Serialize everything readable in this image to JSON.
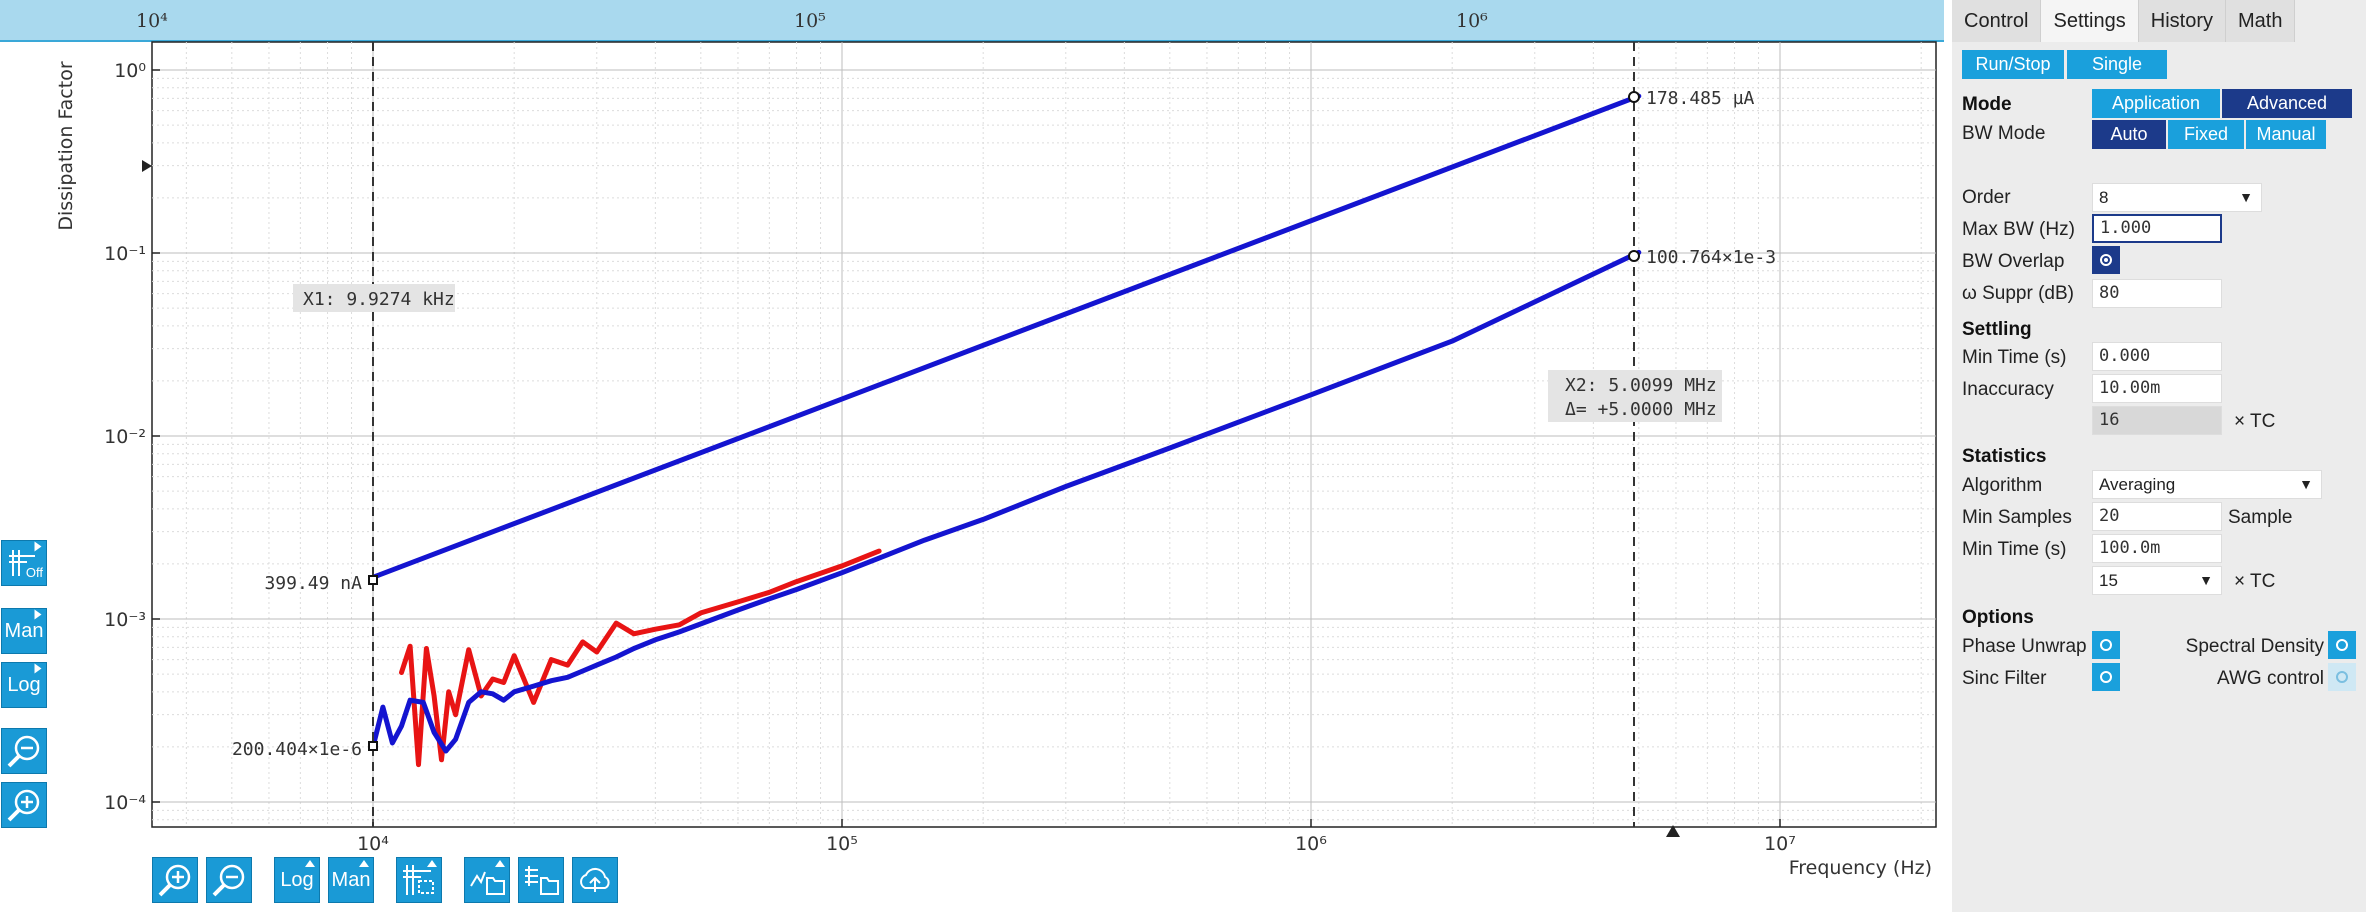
{
  "top_axis": {
    "ticks": [
      "10⁴",
      "10⁵",
      "10⁶"
    ]
  },
  "plot": {
    "y_axis_label": "Dissipation Factor",
    "x_axis_label": "Frequency (Hz)",
    "y_tick_labels": [
      "10⁰",
      "10⁻¹",
      "10⁻²",
      "10⁻³",
      "10⁻⁴"
    ],
    "x_tick_labels": [
      "10⁴",
      "10⁵",
      "10⁶",
      "10⁷"
    ],
    "cursor_x1_label": "X1: 9.9274 kHz",
    "cursor_x2_label": "X2: 5.0099 MHz",
    "cursor_delta_label": "Δ= +5.0000 MHz",
    "marker_upper_left": "399.49 nA",
    "marker_lower_left": "200.404×1e-6",
    "marker_upper_right": "178.485 µA",
    "marker_lower_right": "100.764×1e-3"
  },
  "chart_data": {
    "type": "line",
    "xlabel": "Frequency (Hz)",
    "ylabel": "Dissipation Factor",
    "x_scale": "log",
    "y_scale": "log",
    "xlim": [
      3500,
      25000000
    ],
    "ylim": [
      6e-05,
      1.5
    ],
    "grid": true,
    "series": [
      {
        "color": "#1414d0",
        "x": [
          10000,
          5000000
        ],
        "y": [
          0.00169,
          0.72
        ]
      },
      {
        "color": "#1414d0",
        "x": [
          10000,
          10500,
          11000,
          11500,
          12000,
          12800,
          13500,
          14300,
          15000,
          16000,
          17000,
          18000,
          19000,
          20000,
          22000,
          24000,
          26000,
          28000,
          30000,
          33000,
          36000,
          40000,
          45000,
          50000,
          60000,
          70000,
          80000,
          100000,
          150000,
          200000,
          300000,
          500000,
          1000000,
          2000000,
          5000000
        ],
        "y": [
          0.0002,
          0.00033,
          0.00021,
          0.00026,
          0.00036,
          0.00035,
          0.00024,
          0.00019,
          0.00022,
          0.00035,
          0.0004,
          0.00039,
          0.00036,
          0.0004,
          0.00043,
          0.00046,
          0.00048,
          0.00052,
          0.00056,
          0.00062,
          0.00069,
          0.00077,
          0.00085,
          0.00094,
          0.00112,
          0.00129,
          0.00145,
          0.00179,
          0.0027,
          0.0035,
          0.0053,
          0.0086,
          0.0168,
          0.033,
          0.1008
        ]
      },
      {
        "color": "#e81414",
        "x": [
          11500,
          12000,
          12500,
          13000,
          13500,
          14000,
          14500,
          15000,
          16000,
          17000,
          18000,
          19000,
          20000,
          22000,
          24000,
          26000,
          28000,
          30000,
          33000,
          36000,
          40000,
          45000,
          50000,
          60000,
          70000,
          80000,
          100000,
          120000
        ],
        "y": [
          0.00051,
          0.00071,
          0.00016,
          0.00069,
          0.00038,
          0.00017,
          0.0004,
          0.0003,
          0.00068,
          0.00038,
          0.00047,
          0.00045,
          0.00063,
          0.00035,
          0.0006,
          0.00056,
          0.00075,
          0.00066,
          0.00095,
          0.00083,
          0.00088,
          0.00093,
          0.00108,
          0.00124,
          0.0014,
          0.0016,
          0.00195,
          0.00235
        ]
      }
    ]
  },
  "left_toolbar": {
    "cursor_off_label": "Off",
    "man_label": "Man",
    "log_label": "Log"
  },
  "bottom_toolbar": {
    "log_label": "Log",
    "man_label": "Man"
  },
  "panel": {
    "tabs": [
      "Control",
      "Settings",
      "History",
      "Math"
    ],
    "run_stop_label": "Run/Stop",
    "single_label": "Single",
    "mode_label": "Mode",
    "mode_application": "Application",
    "mode_advanced": "Advanced",
    "bw_mode_label": "BW Mode",
    "bw_auto": "Auto",
    "bw_fixed": "Fixed",
    "bw_manual": "Manual",
    "order_label": "Order",
    "order_value": "8",
    "max_bw_label": "Max BW (Hz)",
    "max_bw_value": "1.000",
    "bw_overlap_label": "BW Overlap",
    "omega_suppr_label": "ω Suppr (dB)",
    "omega_suppr_value": "80",
    "settling_label": "Settling",
    "settling_min_time_label": "Min Time (s)",
    "settling_min_time_value": "0.000",
    "inaccuracy_label": "Inaccuracy",
    "inaccuracy_value": "10.00m",
    "tc_value": "16",
    "tc_unit": "× TC",
    "statistics_label": "Statistics",
    "algorithm_label": "Algorithm",
    "algorithm_value": "Averaging",
    "min_samples_label": "Min Samples",
    "min_samples_value": "20",
    "sample_unit": "Sample",
    "stats_min_time_label": "Min Time (s)",
    "stats_min_time_value": "100.0m",
    "stats_tc_value": "15",
    "stats_tc_unit": "× TC",
    "options_label": "Options",
    "phase_unwrap_label": "Phase Unwrap",
    "spectral_density_label": "Spectral Density",
    "sinc_filter_label": "Sinc Filter",
    "awg_control_label": "AWG control"
  }
}
